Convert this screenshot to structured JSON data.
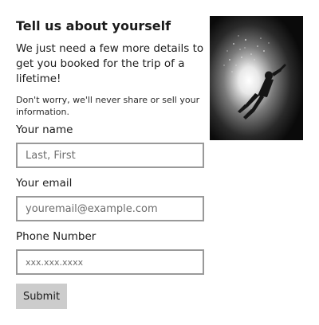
{
  "form": {
    "title": "Tell us about yourself",
    "subtitle": "We just need a few more details to get you booked for the trip of a lifetime!",
    "note": "Don't worry, we'll never share or sell your information.",
    "name_label": "Your name",
    "name_placeholder": "Last, First",
    "email_label": "Your email",
    "email_placeholder": "youremail@example.com",
    "phone_label": "Phone Number",
    "phone_placeholder": "xxx.xxx.xxxx",
    "submit_label": "Submit"
  },
  "image": {
    "subject": "scuba-diver-silhouette"
  },
  "colors": {
    "button_bg": "#cccccc",
    "input_border": "#999999"
  }
}
